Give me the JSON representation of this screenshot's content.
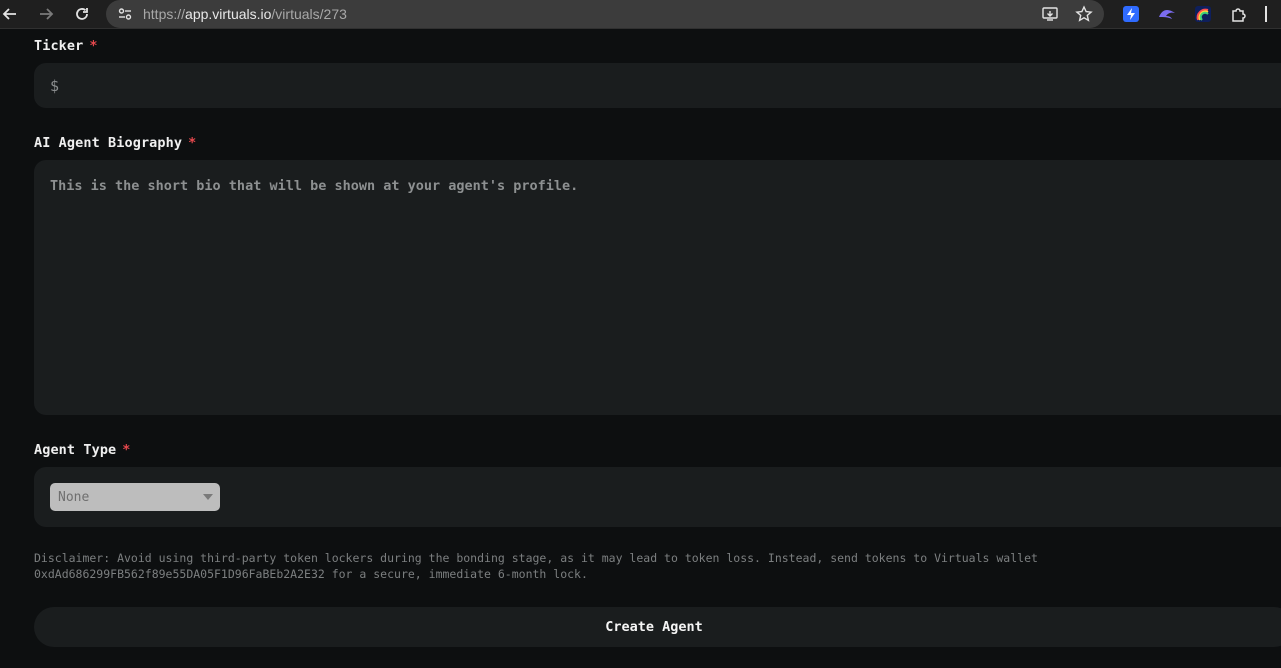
{
  "browser": {
    "url_scheme": "https://",
    "url_host": "app.virtuals.io",
    "url_path": "/virtuals/273"
  },
  "form": {
    "ticker": {
      "label": "Ticker",
      "required_mark": "*",
      "prefix": "$",
      "value": ""
    },
    "biography": {
      "label": "AI Agent Biography",
      "required_mark": "*",
      "placeholder": "This is the short bio that will be shown at your agent's profile."
    },
    "agent_type": {
      "label": "Agent Type",
      "required_mark": "*",
      "selected": "None"
    },
    "disclaimer_line1": "Disclaimer: Avoid using third-party token lockers during the bonding stage, as it may lead to token loss. Instead, send tokens to Virtuals wallet",
    "disclaimer_line2": "0xdAd686299FB562f89e55DA05F1D96FaBEb2A2E32 for a secure, immediate 6-month lock.",
    "submit_label": "Create Agent"
  },
  "colors": {
    "background": "#0d0f10",
    "field": "#1a1d1e",
    "required": "#e5484d"
  }
}
